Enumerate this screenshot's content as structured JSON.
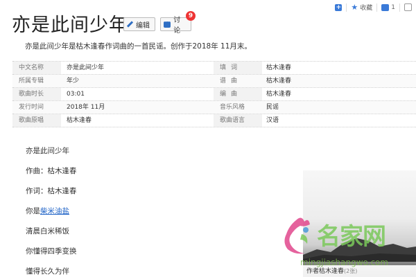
{
  "toolbar": {
    "add_label": "+",
    "favorite_label": "收藏",
    "like_count": "1"
  },
  "title": "亦是此间少年",
  "buttons": {
    "edit": "编辑",
    "discuss": "讨论",
    "discuss_badge": "9"
  },
  "summary": "亦是此间少年是枯木逢春作词曲的一首民谣。创作于2018年 11月末。",
  "info": [
    {
      "l1": "中文名称",
      "v1": "亦是此间少年",
      "l2": "填词",
      "v2": "枯木逢春"
    },
    {
      "l1": "所属专辑",
      "v1": "年少",
      "l2": "谱曲",
      "v2": "枯木逢春"
    },
    {
      "l1": "歌曲时长",
      "v1": "03:01",
      "l2": "编曲",
      "v2": "枯木逢春"
    },
    {
      "l1": "发行时间",
      "v1": "2018年 11月",
      "l2": "音乐风格",
      "v2": "民谣"
    },
    {
      "l1": "歌曲原唱",
      "v1": "枯木逢春",
      "l2": "歌曲语言",
      "v2": "汉语"
    }
  ],
  "lyrics": {
    "line1": "亦是此间少年",
    "line2": "作曲：枯木逢春",
    "line3": "作词：枯木逢春",
    "line4_prefix": "你是",
    "line4_link": "柴米油盐",
    "line5": "清晨白米稀饭",
    "line6": "你懂得四季变换",
    "line7": "懂得长久为伴"
  },
  "photo": {
    "caption": "作者枯木逢春",
    "count": "(2张)"
  },
  "watermark": {
    "text": "名家网",
    "url": "mingjiashangwo.com"
  },
  "colors": {
    "accent": "#3a7ad8",
    "link": "#1f63c7",
    "badge": "#e33333",
    "watermark": "#7bc95b"
  }
}
